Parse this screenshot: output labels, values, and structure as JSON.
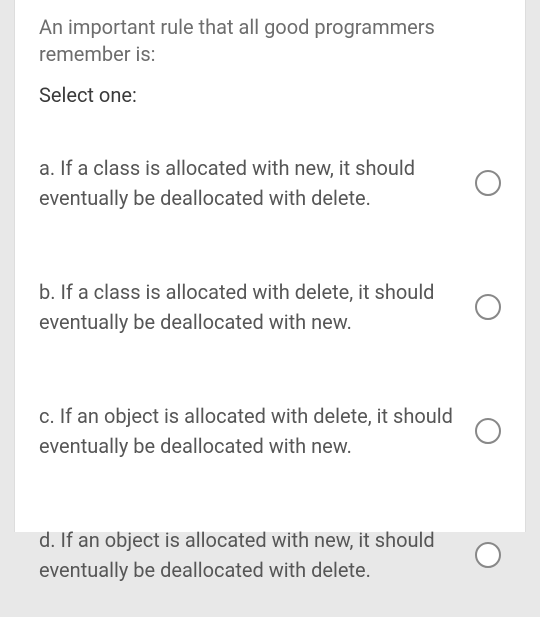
{
  "question": {
    "text": "An important rule that all good programmers remember is:",
    "instruction": "Select one:",
    "options": [
      {
        "label": "a. If a class is allocated with new, it should eventually be deallocated with delete."
      },
      {
        "label": "b. If a class is allocated with delete, it should eventually be deallocated with new."
      },
      {
        "label": "c. If an object is allocated with delete, it should eventually be deallocated with new."
      },
      {
        "label": "d. If an object is allocated with new, it should eventually be deallocated with delete."
      }
    ]
  }
}
